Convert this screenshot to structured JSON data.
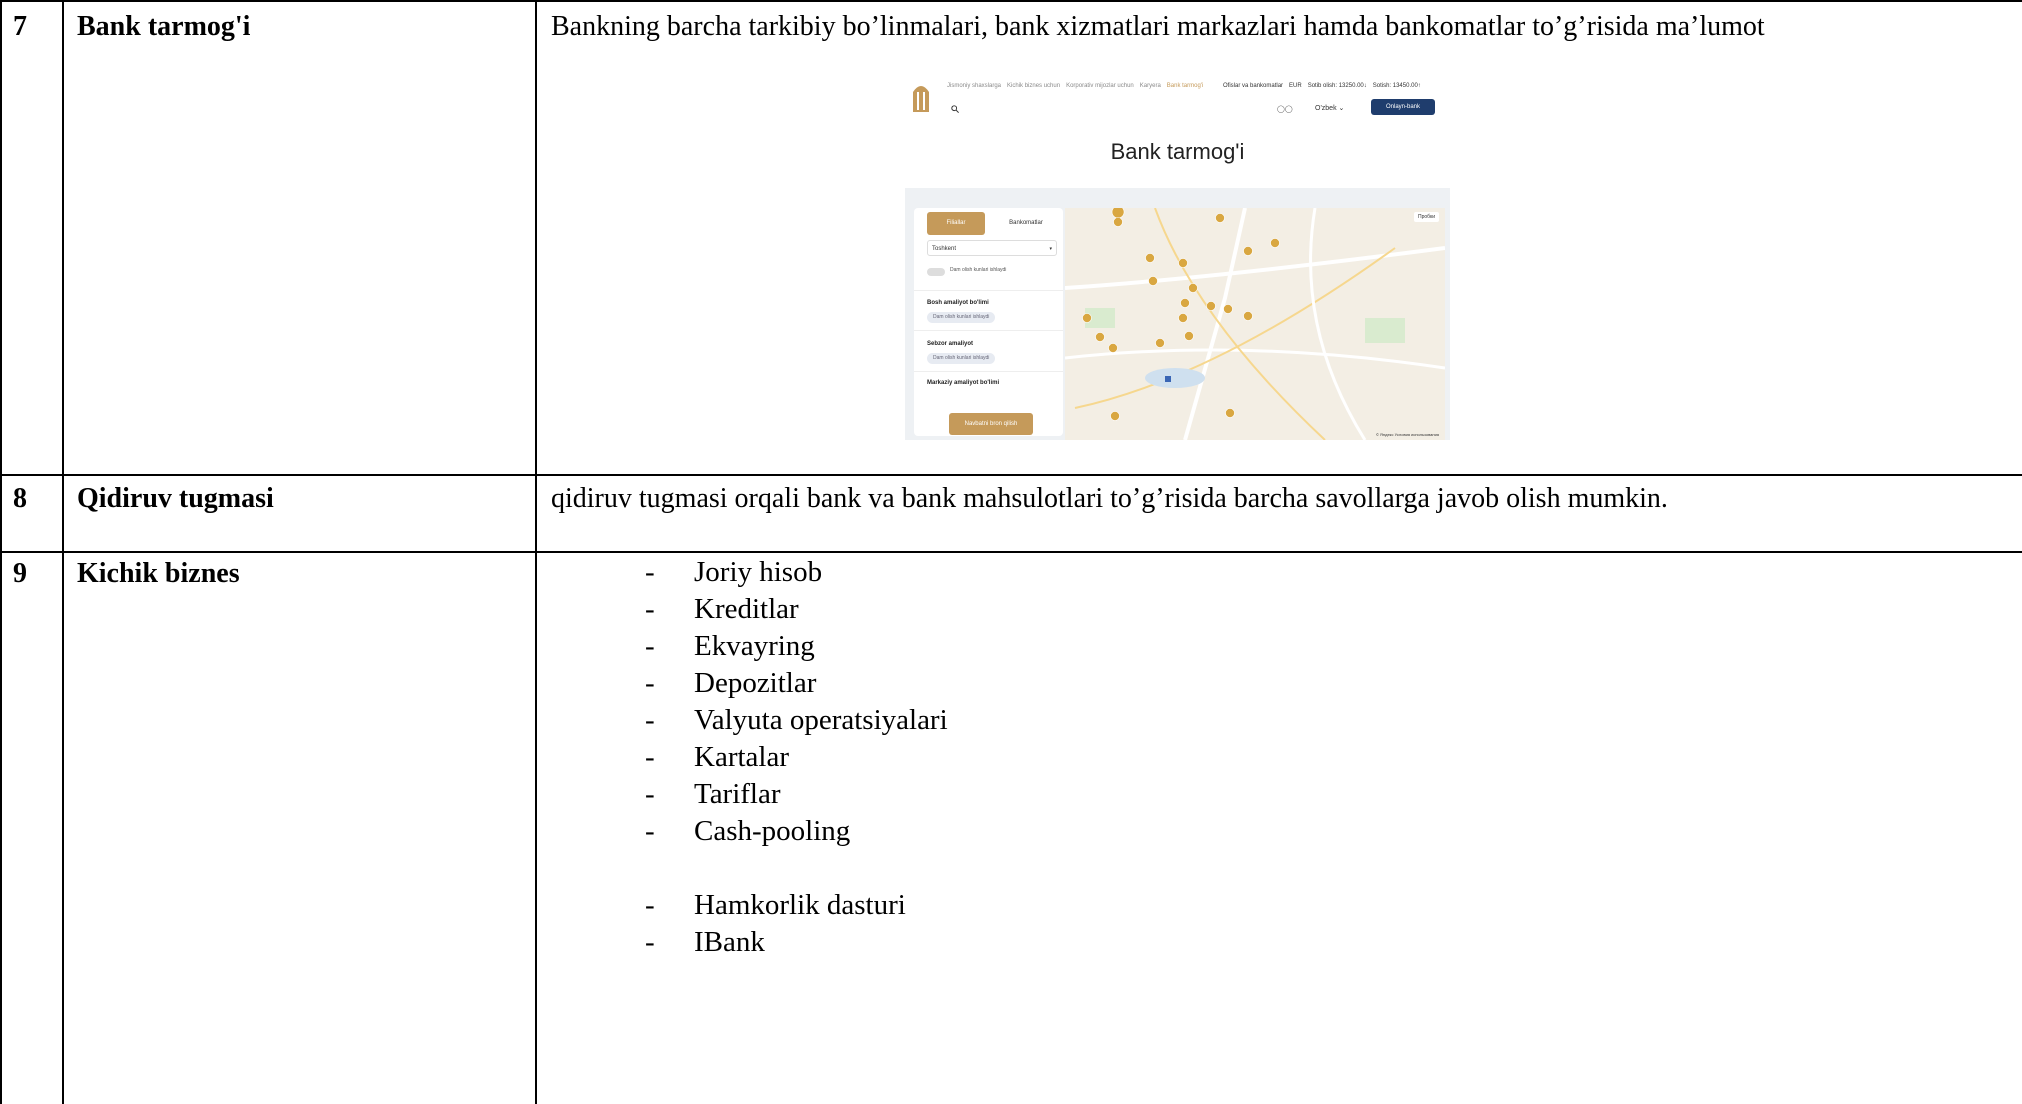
{
  "rows": [
    {
      "num": "7",
      "name": "Bank tarmog'i",
      "description": "Bankning barcha tarkibiy bo’linmalari, bank xizmatlari markazlari hamda bankomatlar to’g’risida ma’lumot"
    },
    {
      "num": "8",
      "name": "Qidiruv tugmasi",
      "description": "qidiruv tugmasi orqali bank va bank mahsulotlari to’g’risida barcha savollarga javob olish mumkin."
    },
    {
      "num": "9",
      "name": "Kichik biznes",
      "list_marker": "-",
      "items": [
        "Joriy hisob",
        "Kreditlar",
        "Ekvayring",
        "Depozitlar",
        "Valyuta operatsiyalari",
        "Kartalar",
        "Tariflar",
        "Cash-pooling"
      ],
      "items_2": [
        "Hamkorlik dasturi",
        "IBank"
      ]
    }
  ],
  "screenshot": {
    "nav": [
      "Jismoniy shaxslarga",
      "Kichik biznes uchun",
      "Korporativ mijozlar uchun",
      "Karyera",
      "Bank tarmog'i"
    ],
    "topright": [
      "Ofislar va bankomatlar",
      "EUR",
      "Sotib olish: 13250.00↓",
      "Sotish: 13450.00↑"
    ],
    "lang": "O'zbek ⌄",
    "online_button": "Onlayn-bank",
    "heading": "Bank tarmog'i",
    "tab_active": "Filiallar",
    "tab_other": "Bankomatlar",
    "city": "Toshkent",
    "toggle_label": "Dam olish kunlari ishlaydi",
    "sections": [
      {
        "title": "Bosh amaliyot bo'limi",
        "chip": "Dam olish kunlari ishlaydi"
      },
      {
        "title": "Sebzor amaliyot",
        "chip": "Dam olish kunlari ishlaydi"
      },
      {
        "title": "Markaziy amaliyot bo'limi",
        "chip": ""
      }
    ],
    "book_button": "Navbatni bron qilish",
    "map_control": "Пробки",
    "map_credit": "© Яндекс Условия использования",
    "colors": {
      "accent": "#c59a5a",
      "navy": "#1f3d6d"
    }
  }
}
